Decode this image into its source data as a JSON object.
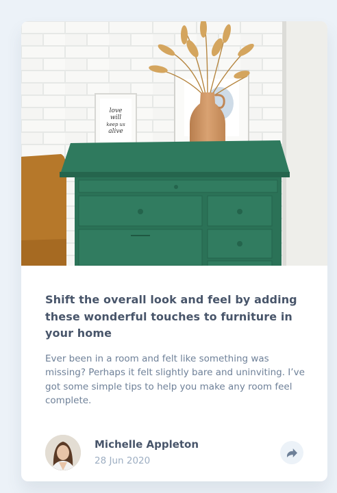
{
  "article": {
    "image_alt": "Green wooden drawer cabinet with a vase of dried grass and framed prints",
    "print_text": "love will keep us alive",
    "title": "Shift the overall look and feel by adding these wonderful touches to furniture in your home",
    "description": "Ever been in a room and felt like something was missing? Perhaps it felt slightly bare and uninviting. I’ve got some simple tips to help you make any room feel complete.",
    "author": {
      "name": "Michelle Appleton",
      "date": "28 Jun 2020",
      "avatar_icon": "avatar-photo"
    },
    "share_icon": "share-icon"
  },
  "colors": {
    "page_bg": "#ECF2F8",
    "title": "#48556A",
    "body_text": "#6E8098",
    "date_text": "#9DAEC2",
    "cabinet_green": "#2F7A5E"
  }
}
